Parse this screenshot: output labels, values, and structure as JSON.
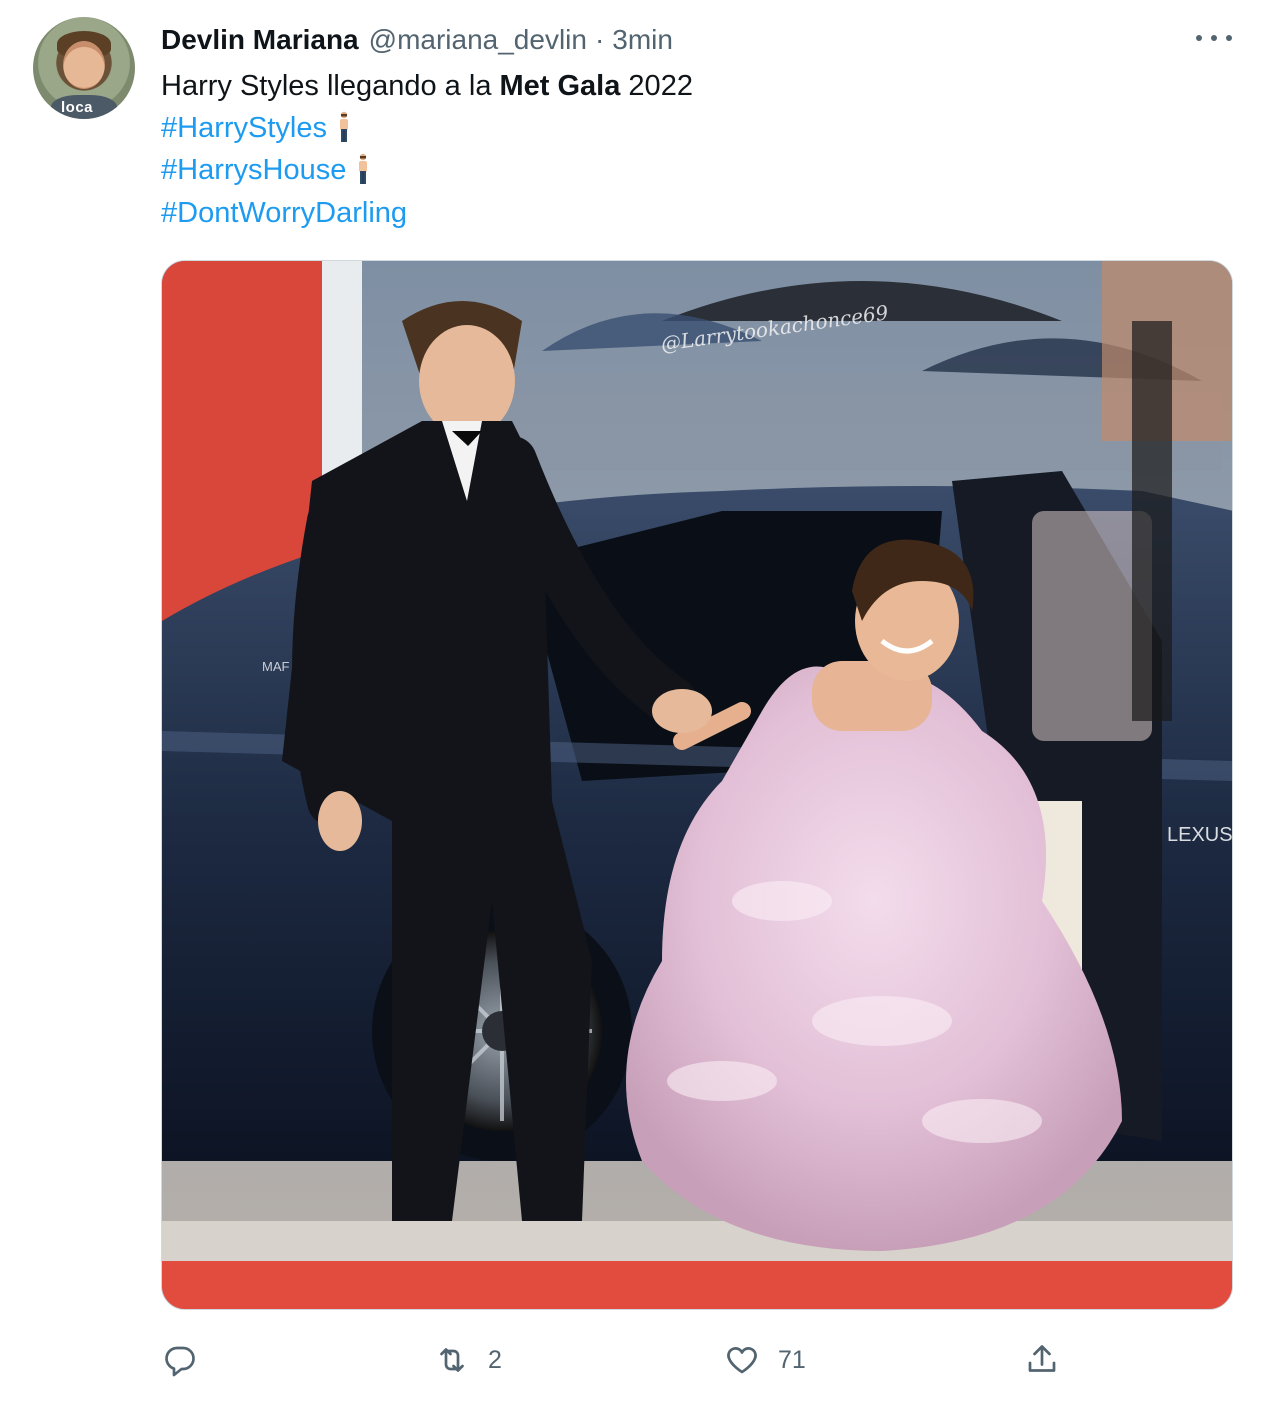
{
  "tweet": {
    "author_name": "Devlin Mariana",
    "handle": "@mariana_devlin",
    "separator": "·",
    "time": "3min",
    "avatar_label": "loca",
    "text_prefix": "Harry Styles llegando a la ",
    "text_bold": "Met Gala",
    "text_suffix": " 2022",
    "hashtags": [
      "#HarryStyles",
      "#HarrysHouse",
      "#DontWorryDarling"
    ],
    "emoji_name": "man-standing-emoji"
  },
  "media": {
    "watermark": "@Larrytookachonce69",
    "car_badge_left": "MAF",
    "car_badge_right": "LEXUS"
  },
  "actions": {
    "reply_count": "",
    "retweet_count": "2",
    "like_count": "71",
    "share_count": ""
  },
  "colors": {
    "link": "#1d9bf0",
    "muted": "#536471",
    "text": "#0f1419",
    "border": "#cfd9de"
  }
}
